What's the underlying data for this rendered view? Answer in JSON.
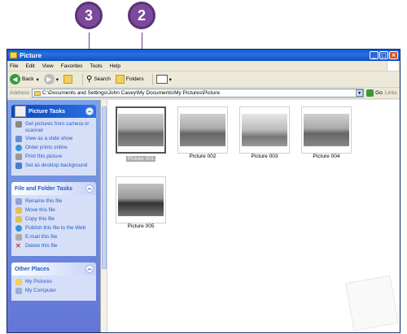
{
  "callouts": {
    "three": "3",
    "two": "2"
  },
  "window": {
    "title": "Picture",
    "menu": [
      "File",
      "Edit",
      "View",
      "Favorites",
      "Tools",
      "Help"
    ],
    "toolbar": {
      "back": "Back",
      "search": "Search",
      "folders": "Folders"
    },
    "address": {
      "label": "Address",
      "value": "C:\\Documents and Settings\\John Casey\\My Documents\\My Pictures\\Picture",
      "go": "Go",
      "links": "Links"
    }
  },
  "taskpane": {
    "picture_tasks": {
      "title": "Picture Tasks",
      "items": [
        "Get pictures from camera or scanner",
        "View as a slide show",
        "Order prints online",
        "Print this picture",
        "Set as desktop background"
      ]
    },
    "file_folder_tasks": {
      "title": "File and Folder Tasks",
      "items": [
        "Rename this file",
        "Move this file",
        "Copy this file",
        "Publish this file to the Web",
        "E-mail this file",
        "Delete this file"
      ]
    },
    "other_places": {
      "title": "Other Places",
      "items": [
        "My Pictures",
        "My Computer"
      ]
    }
  },
  "thumbnails": [
    {
      "label": "Picture 001",
      "selected": true
    },
    {
      "label": "Picture 002",
      "selected": false
    },
    {
      "label": "Picture 003",
      "selected": false
    },
    {
      "label": "Picture 004",
      "selected": false
    },
    {
      "label": "Picture 005",
      "selected": false
    }
  ]
}
